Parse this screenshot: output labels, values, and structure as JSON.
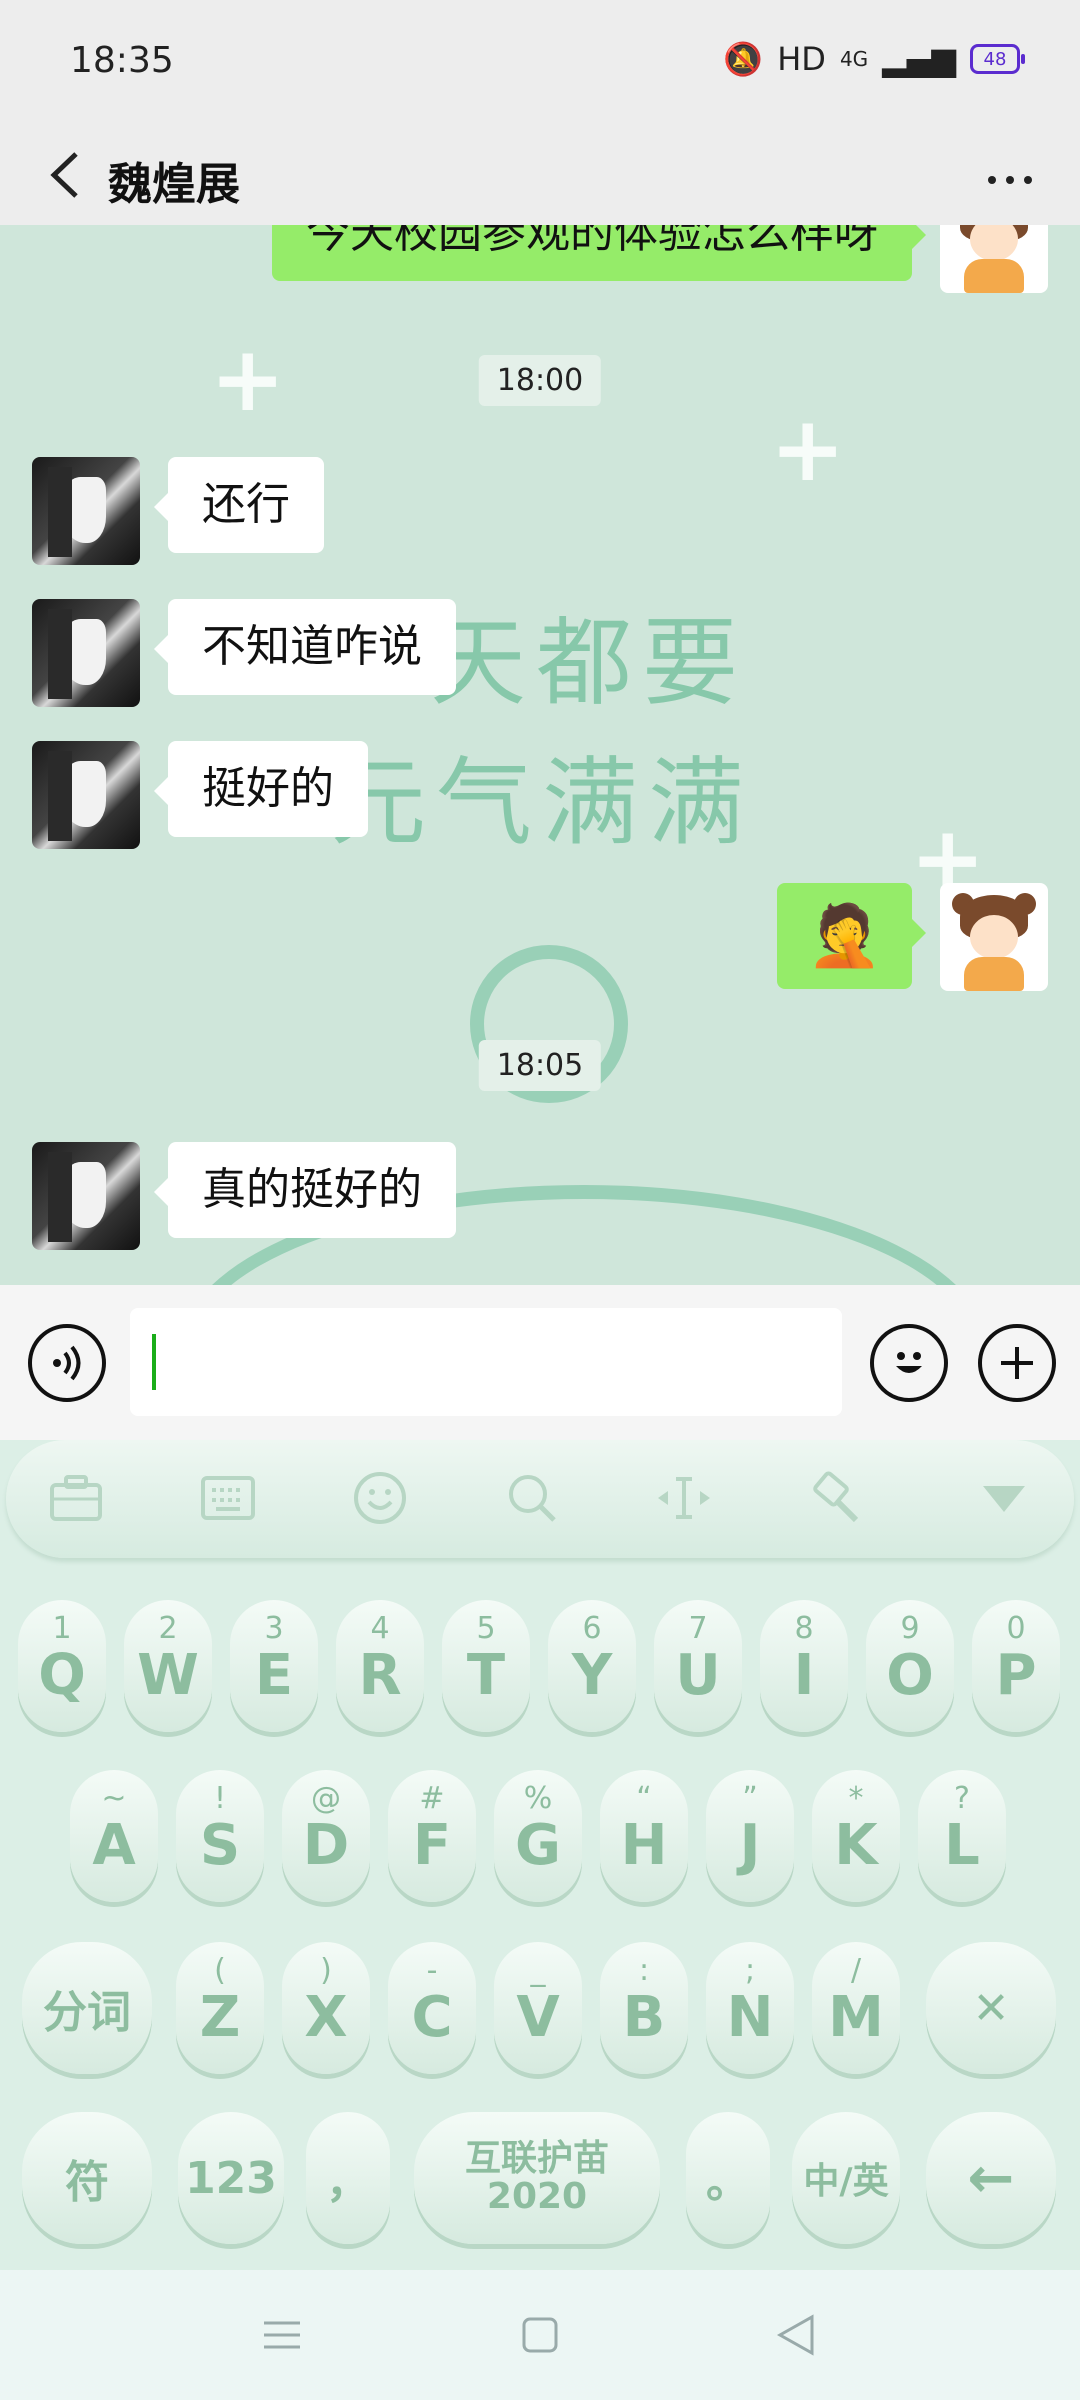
{
  "status_bar": {
    "time": "18:35",
    "hd": "HD",
    "network": "4G",
    "battery": "48"
  },
  "header": {
    "title": "魏煌展"
  },
  "wallpaper": {
    "line1": "天都要",
    "line2": "元气满满"
  },
  "messages": [
    {
      "side": "right",
      "text": "今天校园参观的体验怎么样呀"
    },
    {
      "timestamp": "18:00"
    },
    {
      "side": "left",
      "text": "还行"
    },
    {
      "side": "left",
      "text": "不知道咋说"
    },
    {
      "side": "left",
      "text": "挺好的"
    },
    {
      "side": "right",
      "text": "🤦"
    },
    {
      "timestamp": "18:05"
    },
    {
      "side": "left",
      "text": "真的挺好的"
    }
  ],
  "keyboard": {
    "row1": [
      {
        "alt": "1",
        "main": "Q"
      },
      {
        "alt": "2",
        "main": "W"
      },
      {
        "alt": "3",
        "main": "E"
      },
      {
        "alt": "4",
        "main": "R"
      },
      {
        "alt": "5",
        "main": "T"
      },
      {
        "alt": "6",
        "main": "Y"
      },
      {
        "alt": "7",
        "main": "U"
      },
      {
        "alt": "8",
        "main": "I"
      },
      {
        "alt": "9",
        "main": "O"
      },
      {
        "alt": "0",
        "main": "P"
      }
    ],
    "row2": [
      {
        "alt": "~",
        "main": "A"
      },
      {
        "alt": "!",
        "main": "S"
      },
      {
        "alt": "@",
        "main": "D"
      },
      {
        "alt": "#",
        "main": "F"
      },
      {
        "alt": "%",
        "main": "G"
      },
      {
        "alt": "“",
        "main": "H"
      },
      {
        "alt": "”",
        "main": "J"
      },
      {
        "alt": "*",
        "main": "K"
      },
      {
        "alt": "?",
        "main": "L"
      }
    ],
    "row3": [
      {
        "alt": "(",
        "main": "Z"
      },
      {
        "alt": ")",
        "main": "X"
      },
      {
        "alt": "-",
        "main": "C"
      },
      {
        "alt": "_",
        "main": "V"
      },
      {
        "alt": ":",
        "main": "B"
      },
      {
        "alt": ";",
        "main": "N"
      },
      {
        "alt": "/",
        "main": "M"
      }
    ],
    "fenci": "分词",
    "delete": "✕",
    "fu": "符",
    "num": "123",
    "comma": "，",
    "space_line1": "互联护苗",
    "space_line2": "2020",
    "period": "。",
    "lang": "中/英",
    "enter": "←"
  }
}
